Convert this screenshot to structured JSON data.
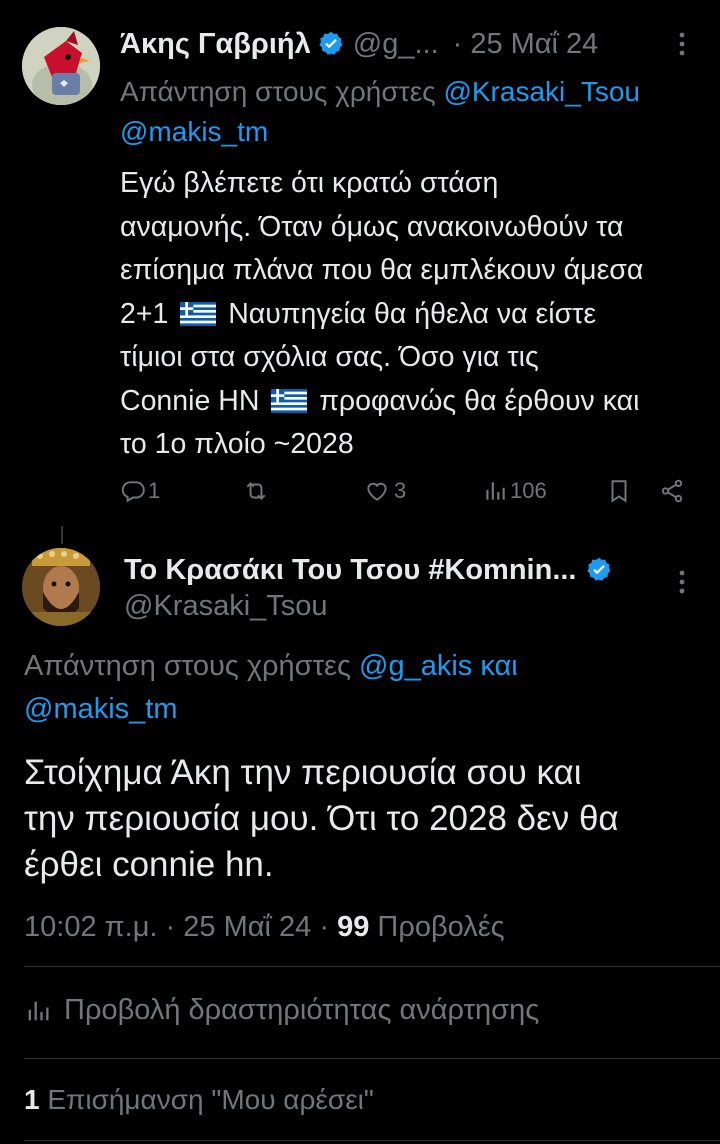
{
  "colors": {
    "background": "#000000",
    "text": "#e7e9ea",
    "muted": "#71767b",
    "link": "#1d9bf0",
    "verified": "#1d9bf0"
  },
  "tweet1": {
    "display_name": "Άκης Γαβριήλ",
    "handle": "@g_...",
    "separator": "·",
    "date": "25 Μαΐ 24",
    "reply_prefix": "Απάντηση στους χρήστες",
    "reply_user1": "@Krasaki_Tsou",
    "reply_user2": "@makis_tm",
    "body_line1": "Εγώ βλέπετε ότι κρατώ στάση",
    "body_line2": "αναμονής. Όταν όμως ανακοινωθούν τα",
    "body_line3": "επίσημα πλάνα που θα εμπλέκουν άμεσα",
    "body_line4_a": "2+1",
    "body_line4_b": "Ναυπηγεία θα ήθελα να είστε",
    "body_line5": "τίμιοι στα σχόλια σας. Όσο για τις",
    "body_line6_a": "Connie HN",
    "body_line6_b": "προφανώς θα έρθουν και",
    "body_line7": "το 1ο πλοίο ~2028",
    "replies": "1",
    "likes": "3",
    "views": "106",
    "icons": [
      "reply-icon",
      "retweet-icon",
      "like-icon",
      "views-icon",
      "bookmark-icon",
      "share-icon",
      "more-icon",
      "verified-icon",
      "greek-flag-icon"
    ]
  },
  "tweet2": {
    "display_name": "Το Κρασάκι Του Τσου #Komnin...",
    "handle": "@Krasaki_Tsou",
    "reply_prefix": "Απάντηση στους χρήστες",
    "reply_user1": "@g_akis",
    "reply_conj": "και",
    "reply_user2": "@makis_tm",
    "body_line1": "Στοίχημα Άκη την περιουσία σου και",
    "body_line2": "την περιουσία μου. Ότι το 2028 δεν θα",
    "body_line3": "έρθει connie hn.",
    "time": "10:02 π.μ.",
    "date": "25 Μαΐ 24",
    "separator": "·",
    "views_count": "99",
    "views_label": "Προβολές",
    "activity_label": "Προβολή δραστηριότητας ανάρτησης",
    "likes_count": "1",
    "likes_label": "Επισήμανση \"Μου αρέσει\""
  }
}
